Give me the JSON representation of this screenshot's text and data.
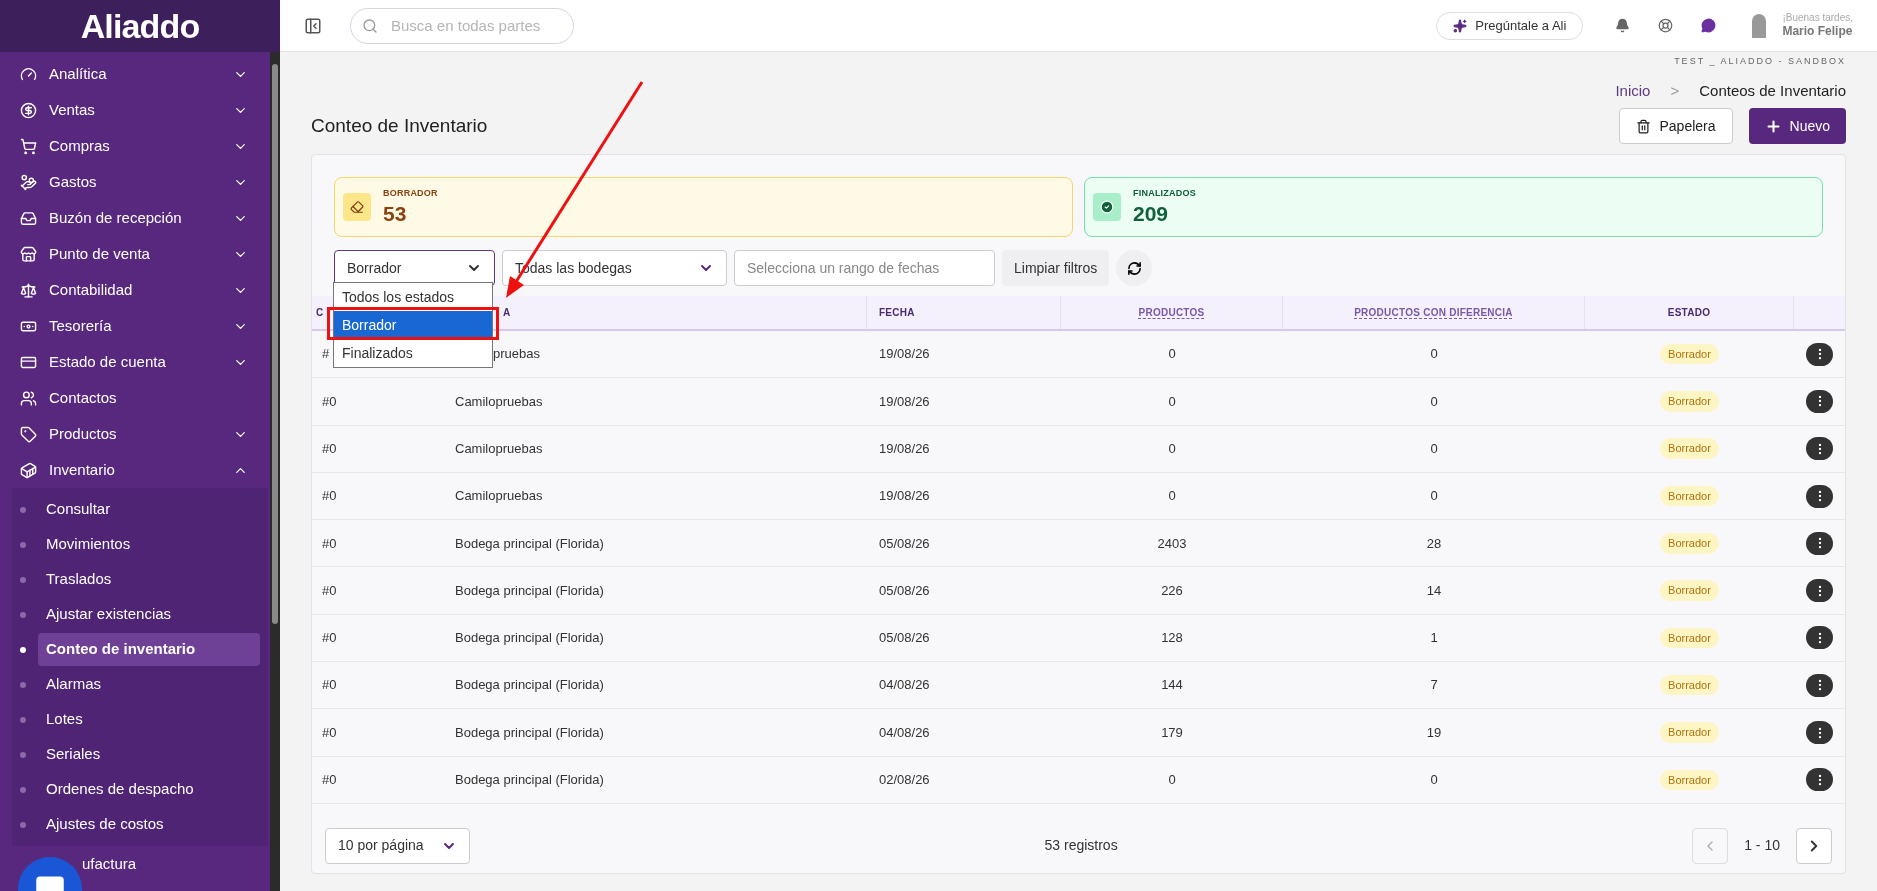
{
  "logo": "Aliaddo",
  "search": {
    "placeholder": "Busca en todas partes"
  },
  "ask_button": "Pregúntale a Ali",
  "user": {
    "greeting": "¡Buenas tardes,",
    "name": "Mario Felipe"
  },
  "sidebar": {
    "items": [
      {
        "label": "Analítica",
        "kind": "group",
        "expanded": false
      },
      {
        "label": "Ventas",
        "kind": "group",
        "expanded": false
      },
      {
        "label": "Compras",
        "kind": "group",
        "expanded": false
      },
      {
        "label": "Gastos",
        "kind": "group",
        "expanded": false
      },
      {
        "label": "Buzón de recepción",
        "kind": "group",
        "expanded": false
      },
      {
        "label": "Punto de venta",
        "kind": "group",
        "expanded": false
      },
      {
        "label": "Contabilidad",
        "kind": "group",
        "expanded": false
      },
      {
        "label": "Tesorería",
        "kind": "group",
        "expanded": false
      },
      {
        "label": "Estado de cuenta",
        "kind": "group",
        "expanded": false
      },
      {
        "label": "Contactos",
        "kind": "link"
      },
      {
        "label": "Productos",
        "kind": "group",
        "expanded": false
      },
      {
        "label": "Inventario",
        "kind": "group",
        "expanded": true,
        "children": [
          {
            "label": "Consultar",
            "selected": false
          },
          {
            "label": "Movimientos",
            "selected": false
          },
          {
            "label": "Traslados",
            "selected": false
          },
          {
            "label": "Ajustar existencias",
            "selected": false
          },
          {
            "label": "Conteo de inventario",
            "selected": true
          },
          {
            "label": "Alarmas",
            "selected": false
          },
          {
            "label": "Lotes",
            "selected": false
          },
          {
            "label": "Seriales",
            "selected": false
          },
          {
            "label": "Ordenes de despacho",
            "selected": false
          },
          {
            "label": "Ajustes de costos",
            "selected": false
          }
        ]
      },
      {
        "label": "ufactura",
        "kind": "covered"
      }
    ]
  },
  "company": "TEST _ ALIADDO - SANDBOX",
  "breadcrumb": [
    "Inicio",
    "Conteos de Inventario"
  ],
  "breadcrumb_separator": ">",
  "page_title": "Conteo de Inventario",
  "actions": [
    {
      "label": "Papelera",
      "kind": "secondary"
    },
    {
      "label": "Nuevo",
      "kind": "primary"
    }
  ],
  "stats": [
    {
      "label": "BORRADOR",
      "value": "53",
      "kind": "draft"
    },
    {
      "label": "FINALIZADOS",
      "value": "209",
      "kind": "done"
    }
  ],
  "filters": {
    "status": "Borrador",
    "warehouse": "Todas las bodegas",
    "date_placeholder": "Selecciona un rango de fechas",
    "clear": "Limpiar filtros"
  },
  "status_options": [
    {
      "label": "Todos los estados",
      "selected": false
    },
    {
      "label": "Borrador",
      "selected": true
    },
    {
      "label": "Finalizados",
      "selected": false
    }
  ],
  "table": {
    "columns": [
      {
        "label": "C",
        "underlined": false
      },
      {
        "label": "A",
        "underlined": false
      },
      {
        "label": "FECHA",
        "underlined": false
      },
      {
        "label": "PRODUCTOS",
        "underlined": true
      },
      {
        "label": "PRODUCTOS CON DIFERENCIA",
        "underlined": true
      },
      {
        "label": "ESTADO",
        "underlined": false
      }
    ],
    "rows": [
      {
        "kind": "covered",
        "cells": [
          "#",
          "pruebas",
          "19/08/26",
          "0",
          "0",
          "Borrador"
        ]
      },
      {
        "kind": "plain",
        "cells": [
          "#0",
          "Camilopruebas",
          "19/08/26",
          "0",
          "0",
          "Borrador"
        ]
      },
      {
        "kind": "plain",
        "cells": [
          "#0",
          "Camilopruebas",
          "19/08/26",
          "0",
          "0",
          "Borrador"
        ]
      },
      {
        "kind": "plain",
        "cells": [
          "#0",
          "Camilopruebas",
          "19/08/26",
          "0",
          "0",
          "Borrador"
        ]
      },
      {
        "kind": "plain",
        "cells": [
          "#0",
          "Bodega principal (Florida)",
          "05/08/26",
          "2403",
          "28",
          "Borrador"
        ]
      },
      {
        "kind": "plain",
        "cells": [
          "#0",
          "Bodega principal (Florida)",
          "05/08/26",
          "226",
          "14",
          "Borrador"
        ]
      },
      {
        "kind": "plain",
        "cells": [
          "#0",
          "Bodega principal (Florida)",
          "05/08/26",
          "128",
          "1",
          "Borrador"
        ]
      },
      {
        "kind": "plain",
        "cells": [
          "#0",
          "Bodega principal (Florida)",
          "04/08/26",
          "144",
          "7",
          "Borrador"
        ]
      },
      {
        "kind": "plain",
        "cells": [
          "#0",
          "Bodega principal (Florida)",
          "04/08/26",
          "179",
          "19",
          "Borrador"
        ]
      },
      {
        "kind": "plain",
        "cells": [
          "#0",
          "Bodega principal (Florida)",
          "02/08/26",
          "0",
          "0",
          "Borrador"
        ]
      }
    ]
  },
  "pagination": {
    "per_page": "10 por página",
    "total": "53 registros",
    "range": "1 - 10"
  }
}
